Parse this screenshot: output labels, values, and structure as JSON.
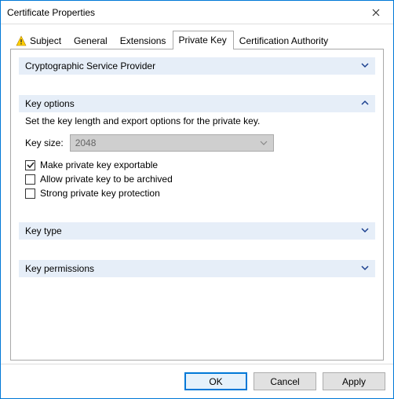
{
  "window": {
    "title": "Certificate Properties"
  },
  "tabs": {
    "subject": {
      "label": "Subject"
    },
    "general": {
      "label": "General"
    },
    "ext": {
      "label": "Extensions"
    },
    "pkey": {
      "label": "Private Key"
    },
    "ca": {
      "label": "Certification Authority"
    }
  },
  "sections": {
    "csp": {
      "title": "Cryptographic Service Provider"
    },
    "kopt": {
      "title": "Key options",
      "desc": "Set the key length and export options for the private key.",
      "keysize_label": "Key size:",
      "keysize_value": "2048",
      "exportable": "Make private key exportable",
      "archive": "Allow private key to be archived",
      "strong": "Strong private key protection"
    },
    "ktype": {
      "title": "Key type"
    },
    "kperm": {
      "title": "Key permissions"
    }
  },
  "buttons": {
    "ok": "OK",
    "cancel": "Cancel",
    "apply": "Apply"
  }
}
